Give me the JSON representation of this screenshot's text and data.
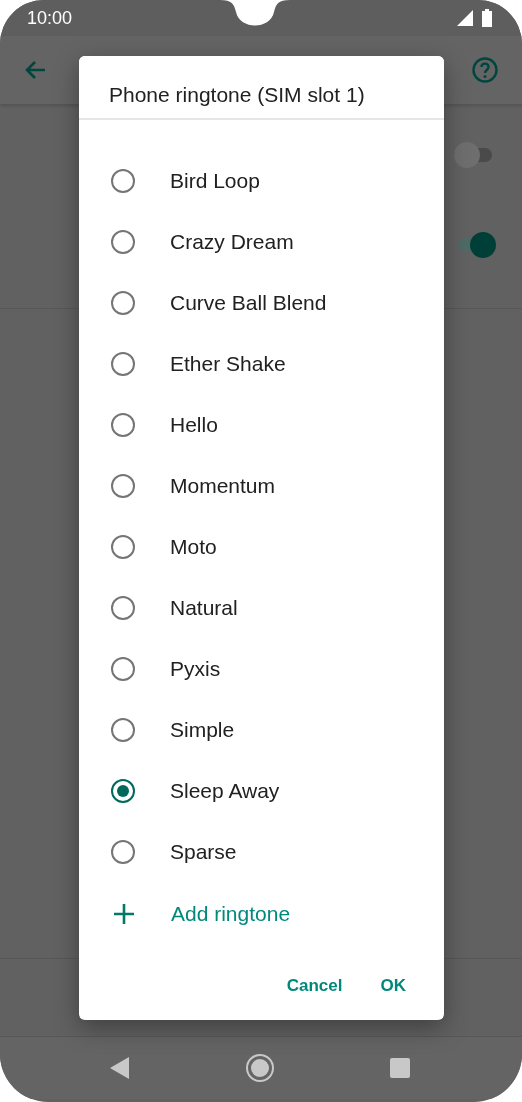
{
  "status_bar": {
    "time": "10:00"
  },
  "background_settings": {
    "toggles": [
      {
        "on": false
      },
      {
        "on": true
      }
    ]
  },
  "dialog": {
    "title": "Phone ringtone (SIM slot 1)",
    "options": [
      {
        "label": "Bird Loop",
        "selected": false
      },
      {
        "label": "Crazy Dream",
        "selected": false
      },
      {
        "label": "Curve Ball Blend",
        "selected": false
      },
      {
        "label": "Ether Shake",
        "selected": false
      },
      {
        "label": "Hello",
        "selected": false
      },
      {
        "label": "Momentum",
        "selected": false
      },
      {
        "label": "Moto",
        "selected": false
      },
      {
        "label": "Natural",
        "selected": false
      },
      {
        "label": "Pyxis",
        "selected": false
      },
      {
        "label": "Simple",
        "selected": false
      },
      {
        "label": "Sleep Away",
        "selected": true
      },
      {
        "label": "Sparse",
        "selected": false
      }
    ],
    "add_action": "Add ringtone",
    "buttons": [
      "Cancel",
      "OK"
    ]
  }
}
